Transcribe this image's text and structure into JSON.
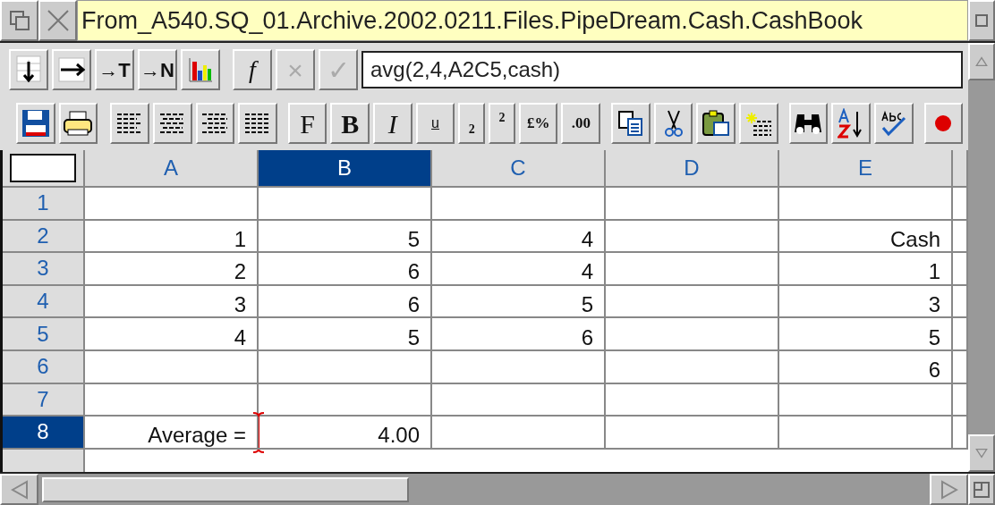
{
  "window": {
    "title": "From_A540.SQ_01.Archive.2002.0211.Files.PipeDream.Cash.CashBook"
  },
  "toolbar_1": {
    "buttons": [
      {
        "label": "→T",
        "disabled": false
      },
      {
        "label": "→N",
        "disabled": false
      },
      {
        "label": "f",
        "disabled": false
      },
      {
        "label": "×",
        "disabled": true
      },
      {
        "label": "✓",
        "disabled": true
      }
    ],
    "formula": {
      "value": "avg(2,4,A2C5,cash)"
    }
  },
  "toolbar_2": {
    "buttons": [
      {
        "kind": "serif",
        "label": "F"
      },
      {
        "kind": "bold",
        "label": "B"
      },
      {
        "kind": "italic",
        "label": "I"
      },
      {
        "kind": "underline",
        "label": "u"
      },
      {
        "kind": "subscript",
        "label": "2"
      },
      {
        "kind": "superscript",
        "label": "2"
      },
      {
        "kind": "plain",
        "label": "£%"
      },
      {
        "kind": "plain",
        "label": ".00"
      }
    ]
  },
  "sheet": {
    "columns": [
      {
        "label": "A",
        "selected": false
      },
      {
        "label": "B",
        "selected": true
      },
      {
        "label": "C",
        "selected": false
      },
      {
        "label": "D",
        "selected": false
      },
      {
        "label": "E",
        "selected": false
      }
    ],
    "rows": [
      {
        "label": "1",
        "selected": false,
        "cells": [
          null,
          null,
          null,
          null,
          null
        ]
      },
      {
        "label": "2",
        "selected": false,
        "cells": [
          "1",
          "5",
          "4",
          null,
          "Cash"
        ]
      },
      {
        "label": "3",
        "selected": false,
        "cells": [
          "2",
          "6",
          "4",
          null,
          "1"
        ]
      },
      {
        "label": "4",
        "selected": false,
        "cells": [
          "3",
          "6",
          "5",
          null,
          "3"
        ]
      },
      {
        "label": "5",
        "selected": false,
        "cells": [
          "4",
          "5",
          "6",
          null,
          "5"
        ]
      },
      {
        "label": "6",
        "selected": false,
        "cells": [
          null,
          null,
          null,
          null,
          "6"
        ]
      },
      {
        "label": "7",
        "selected": false,
        "cells": [
          null,
          null,
          null,
          null,
          null
        ]
      },
      {
        "label": "8",
        "selected": true,
        "cells": [
          "Average =",
          "4.00",
          null,
          null,
          null
        ]
      }
    ]
  }
}
